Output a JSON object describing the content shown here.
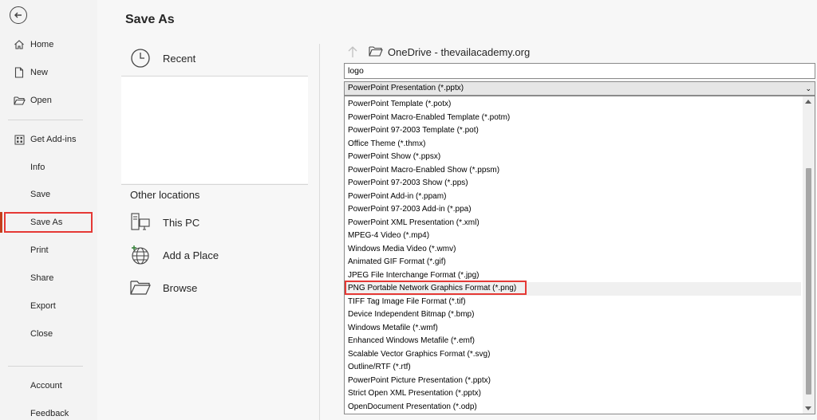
{
  "nav": {
    "items": [
      {
        "key": "home",
        "label": "Home",
        "icon": "home-icon"
      },
      {
        "key": "new",
        "label": "New",
        "icon": "new-doc-icon"
      },
      {
        "key": "open",
        "label": "Open",
        "icon": "folder-open-icon"
      },
      {
        "key": "addins",
        "label": "Get Add-ins",
        "icon": "grid-icon"
      },
      {
        "key": "info",
        "label": "Info"
      },
      {
        "key": "save",
        "label": "Save"
      },
      {
        "key": "saveas",
        "label": "Save As"
      },
      {
        "key": "print",
        "label": "Print"
      },
      {
        "key": "share",
        "label": "Share"
      },
      {
        "key": "export",
        "label": "Export"
      },
      {
        "key": "close",
        "label": "Close"
      },
      {
        "key": "account",
        "label": "Account"
      },
      {
        "key": "feedback",
        "label": "Feedback"
      }
    ]
  },
  "middle": {
    "title": "Save As",
    "recent": "Recent",
    "other_locations": "Other locations",
    "this_pc": "This PC",
    "add_place": "Add a Place",
    "browse": "Browse"
  },
  "right": {
    "path": "OneDrive - thevailacademy.org",
    "filename": "logo",
    "selected_type": "PowerPoint Presentation (*.pptx)",
    "options": [
      "PowerPoint Template (*.potx)",
      "PowerPoint Macro-Enabled Template (*.potm)",
      "PowerPoint 97-2003 Template (*.pot)",
      "Office Theme (*.thmx)",
      "PowerPoint Show (*.ppsx)",
      "PowerPoint Macro-Enabled Show (*.ppsm)",
      "PowerPoint 97-2003 Show (*.pps)",
      "PowerPoint Add-in (*.ppam)",
      "PowerPoint 97-2003 Add-in (*.ppa)",
      "PowerPoint XML Presentation (*.xml)",
      "MPEG-4 Video (*.mp4)",
      "Windows Media Video (*.wmv)",
      "Animated GIF Format (*.gif)",
      "JPEG File Interchange Format (*.jpg)",
      "PNG Portable Network Graphics Format (*.png)",
      "TIFF Tag Image File Format (*.tif)",
      "Device Independent Bitmap (*.bmp)",
      "Windows Metafile (*.wmf)",
      "Enhanced Windows Metafile (*.emf)",
      "Scalable Vector Graphics Format (*.svg)",
      "Outline/RTF (*.rtf)",
      "PowerPoint Picture Presentation (*.pptx)",
      "Strict Open XML Presentation (*.pptx)",
      "OpenDocument Presentation (*.odp)"
    ]
  },
  "colors": {
    "highlight": "#e53935",
    "accent": "#c43e1c"
  }
}
